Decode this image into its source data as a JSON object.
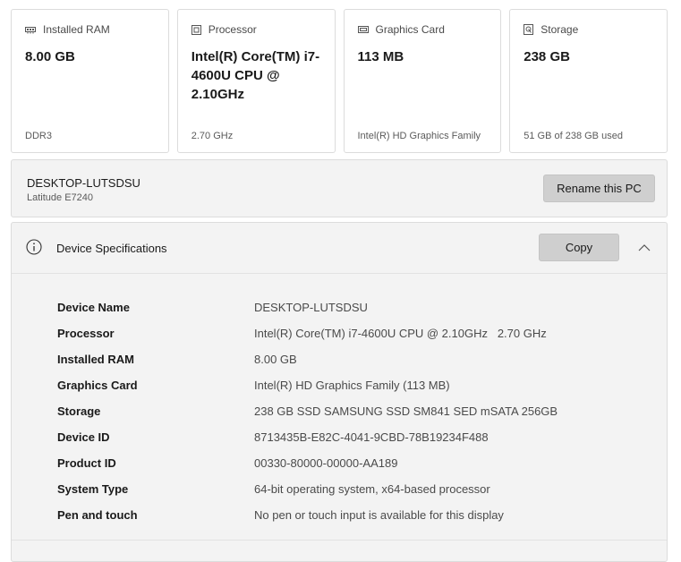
{
  "cards": [
    {
      "title": "Installed RAM",
      "icon": "memory-icon",
      "value": "8.00 GB",
      "footer": "DDR3"
    },
    {
      "title": "Processor",
      "icon": "processor-icon",
      "value": "Intel(R) Core(TM) i7-4600U CPU @ 2.10GHz",
      "footer": "2.70 GHz"
    },
    {
      "title": "Graphics Card",
      "icon": "graphics-card-icon",
      "value": "113 MB",
      "footer": "Intel(R) HD Graphics Family"
    },
    {
      "title": "Storage",
      "icon": "storage-icon",
      "value": "238 GB",
      "footer": "51 GB of 238 GB used"
    }
  ],
  "pc": {
    "name": "DESKTOP-LUTSDSU",
    "model": "Latitude E7240",
    "rename_label": "Rename this PC"
  },
  "specs": {
    "title": "Device Specifications",
    "copy_label": "Copy",
    "rows": [
      {
        "label": "Device Name",
        "value": "DESKTOP-LUTSDSU"
      },
      {
        "label": "Processor",
        "value": "Intel(R) Core(TM) i7-4600U CPU @ 2.10GHz   2.70 GHz"
      },
      {
        "label": "Installed RAM",
        "value": "8.00 GB"
      },
      {
        "label": "Graphics Card",
        "value": "Intel(R) HD Graphics Family (113 MB)"
      },
      {
        "label": "Storage",
        "value": "238 GB SSD SAMSUNG SSD SM841 SED mSATA 256GB"
      },
      {
        "label": "Device ID",
        "value": "8713435B-E82C-4041-9CBD-78B19234F488"
      },
      {
        "label": "Product ID",
        "value": "00330-80000-00000-AA189"
      },
      {
        "label": "System Type",
        "value": "64-bit operating system, x64-based processor"
      },
      {
        "label": "Pen and touch",
        "value": "No pen or touch input is available for this display"
      }
    ]
  },
  "colors": {
    "panel_bg": "#f3f3f3",
    "button_bg": "#cfcfcf",
    "border": "#dcdcdc"
  }
}
